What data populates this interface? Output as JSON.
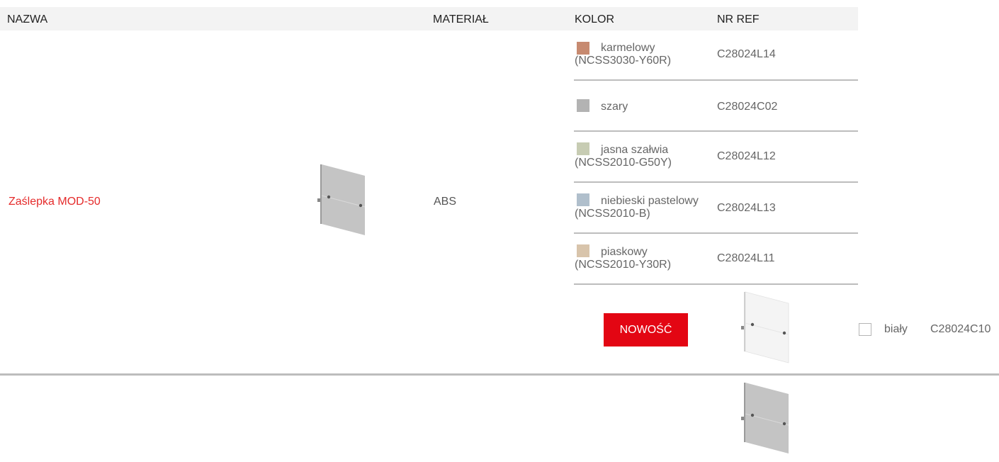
{
  "header": {
    "name": "NAZWA",
    "material": "MATERIAŁ",
    "color": "KOLOR",
    "ref": "NR REF"
  },
  "product": {
    "name": "Zaślepka MOD-50",
    "material": "ABS"
  },
  "colors": [
    {
      "line1": "karmelowy",
      "line2": "(NCSS3030-Y60R)",
      "ref": "C28024L14",
      "swatch": "#c78a70"
    },
    {
      "line1": "szary",
      "line2": "",
      "ref": "C28024C02",
      "swatch": "#b3b3b3"
    },
    {
      "line1": "jasna szałwia",
      "line2": "(NCSS2010-G50Y)",
      "ref": "C28024L12",
      "swatch": "#c7ccb3"
    },
    {
      "line1": "niebieski pastelowy",
      "line2": "(NCSS2010-B)",
      "ref": "C28024L13",
      "swatch": "#b0bfcc"
    },
    {
      "line1": "piaskowy",
      "line2": "(NCSS2010-Y30R)",
      "ref": "C28024L11",
      "swatch": "#d8c4ab"
    }
  ],
  "new_badge": "NOWOŚĆ",
  "new_item": {
    "color": "biały",
    "ref": "C28024C10"
  }
}
